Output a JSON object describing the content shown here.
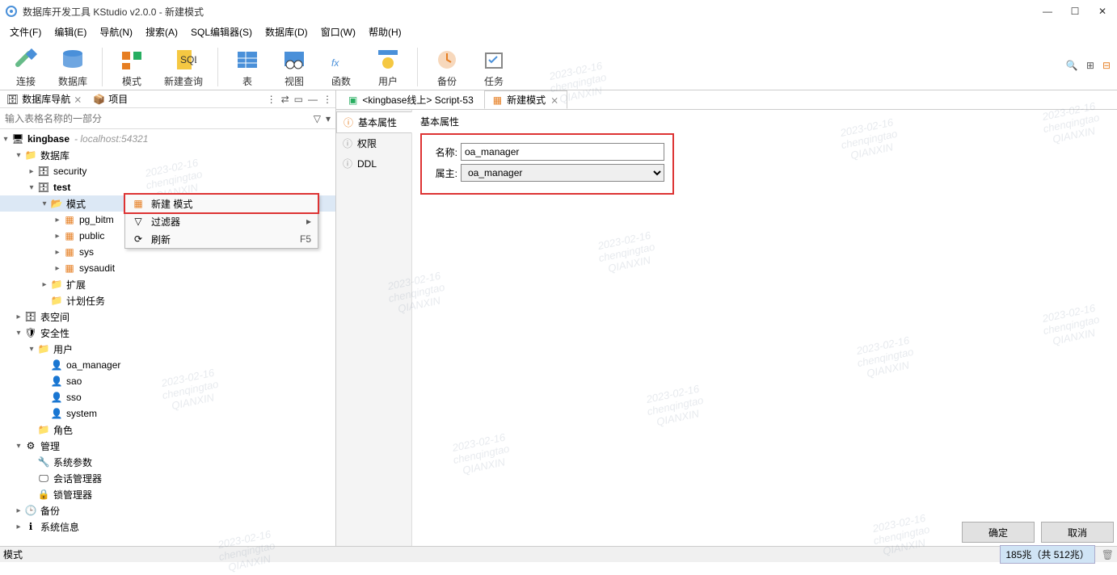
{
  "title": "数据库开发工具 KStudio v2.0.0 - 新建模式",
  "win": {
    "min": "—",
    "max": "☐",
    "close": "✕"
  },
  "menu": [
    "文件(F)",
    "编辑(E)",
    "导航(N)",
    "搜索(A)",
    "SQL编辑器(S)",
    "数据库(D)",
    "窗口(W)",
    "帮助(H)"
  ],
  "toolbar": [
    {
      "label": "连接",
      "icon": "plug"
    },
    {
      "label": "数据库",
      "icon": "db"
    },
    {
      "sep": true
    },
    {
      "label": "模式",
      "icon": "schema"
    },
    {
      "label": "新建查询",
      "icon": "sql"
    },
    {
      "sep": true
    },
    {
      "label": "表",
      "icon": "table"
    },
    {
      "label": "视图",
      "icon": "view"
    },
    {
      "label": "函数",
      "icon": "fx"
    },
    {
      "label": "用户",
      "icon": "user"
    },
    {
      "sep": true
    },
    {
      "label": "备份",
      "icon": "backup"
    },
    {
      "label": "任务",
      "icon": "task"
    }
  ],
  "sidebar": {
    "tabs": {
      "nav": "数据库导航",
      "proj": "项目"
    },
    "filter_placeholder": "输入表格名称的一部分",
    "root": {
      "label": "kingbase",
      "annot": "- localhost:54321"
    },
    "databases": "数据库",
    "security_db": "security",
    "test_db": "test",
    "schema": "模式",
    "schema_items": [
      "pg_bitm",
      "public",
      "sys",
      "sysaudit"
    ],
    "ext": "扩展",
    "plan": "计划任务",
    "tablespace": "表空间",
    "security": "安全性",
    "users": "用户",
    "user_list": [
      "oa_manager",
      "sao",
      "sso",
      "system"
    ],
    "roles": "角色",
    "manage": "管理",
    "manage_items": [
      "系统参数",
      "会话管理器",
      "锁管理器"
    ],
    "backup": "备份",
    "sysinfo": "系统信息"
  },
  "ctx": {
    "new": "新建 模式",
    "filter": "过滤器",
    "refresh": "刷新",
    "refresh_key": "F5"
  },
  "editor": {
    "tab1": "<kingbase线上> Script-53",
    "tab2": "新建模式",
    "nav": {
      "basic": "基本属性",
      "perm": "权限",
      "ddl": "DDL"
    },
    "section": "基本属性",
    "name_label": "名称:",
    "owner_label": "属主:",
    "name_value": "oa_manager",
    "owner_value": "oa_manager",
    "ok": "确定",
    "cancel": "取消"
  },
  "status": {
    "mode": "模式",
    "mem": "185兆（共 512兆）"
  },
  "watermark": "2023-02-16\nchenqingtao\nQIANXIN"
}
